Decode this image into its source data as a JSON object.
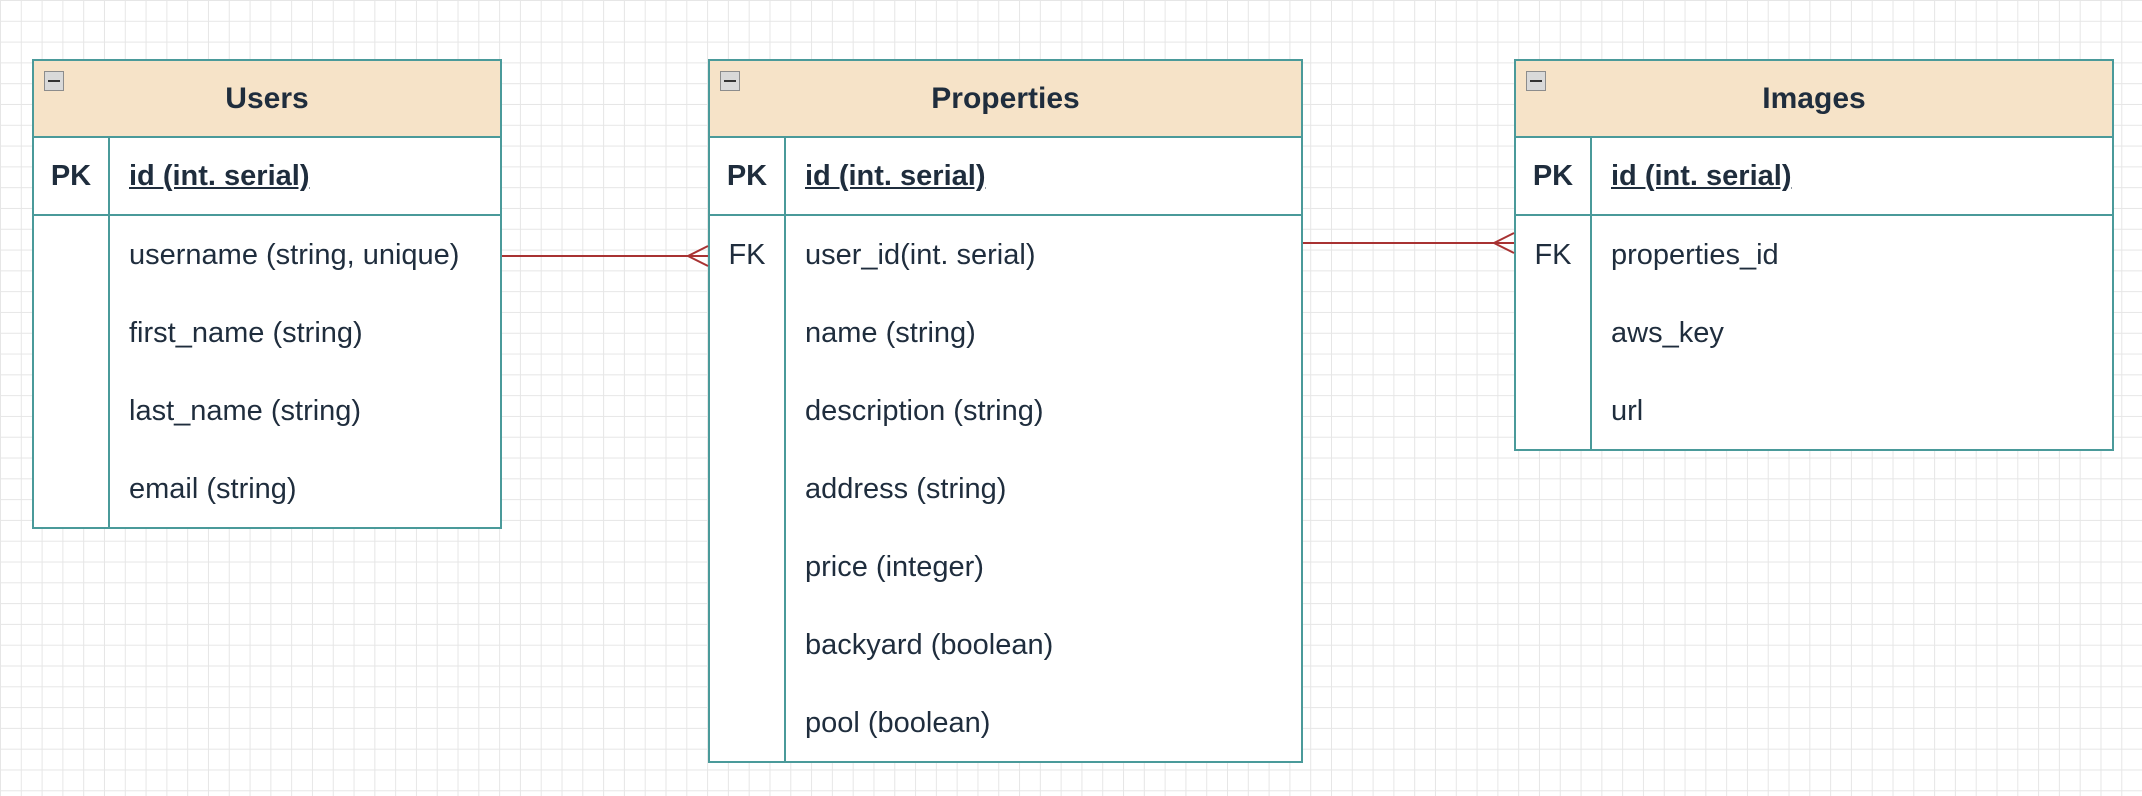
{
  "tables": {
    "users": {
      "title": "Users",
      "pk": {
        "key": "PK",
        "field": "id (int. serial)"
      },
      "rows": [
        {
          "key": "",
          "field": "username (string, unique)"
        },
        {
          "key": "",
          "field": "first_name (string)"
        },
        {
          "key": "",
          "field": "last_name (string)"
        },
        {
          "key": "",
          "field": "email (string)"
        }
      ]
    },
    "properties": {
      "title": "Properties",
      "pk": {
        "key": "PK",
        "field": "id (int. serial)"
      },
      "rows": [
        {
          "key": "FK",
          "field": "user_id(int. serial)"
        },
        {
          "key": "",
          "field": "name (string)"
        },
        {
          "key": "",
          "field": "description (string)"
        },
        {
          "key": "",
          "field": "address (string)"
        },
        {
          "key": "",
          "field": "price (integer)"
        },
        {
          "key": "",
          "field": "backyard (boolean)"
        },
        {
          "key": "",
          "field": "pool (boolean)"
        }
      ]
    },
    "images": {
      "title": "Images",
      "pk": {
        "key": "PK",
        "field": "id (int. serial)"
      },
      "rows": [
        {
          "key": "FK",
          "field": "properties_id"
        },
        {
          "key": "",
          "field": "aws_key"
        },
        {
          "key": "",
          "field": "url"
        }
      ]
    }
  },
  "relationships": [
    {
      "from": "users",
      "to": "properties",
      "type": "one-to-many"
    },
    {
      "from": "properties",
      "to": "images",
      "type": "one-to-many"
    }
  ],
  "colors": {
    "border": "#4a9a9a",
    "header_fill": "#f6e3c8",
    "connector": "#a83232",
    "text": "#1f2d3d"
  },
  "icons": {
    "collapse": "minus-square-icon"
  }
}
